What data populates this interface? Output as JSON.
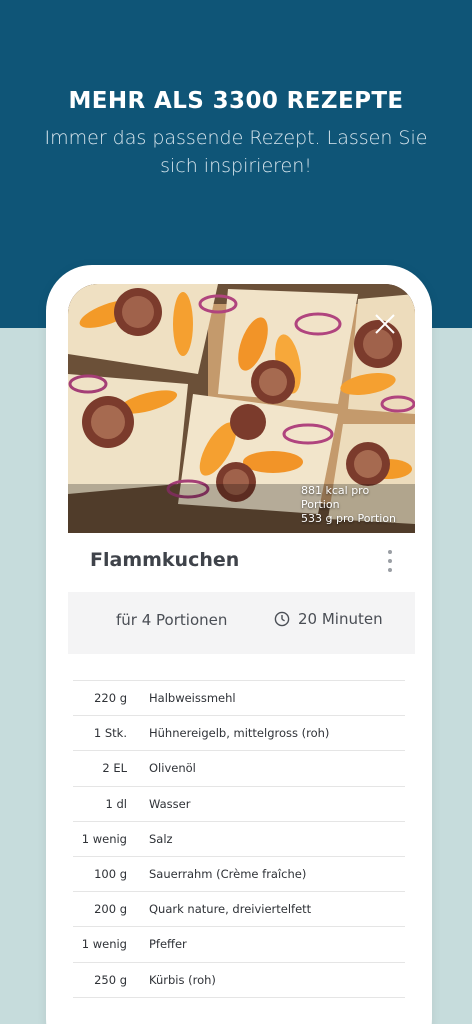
{
  "header": {
    "headline": "MEHR ALS 3300 REZEPTE",
    "subline": "Immer das passende Rezept. Lassen Sie sich inspirieren!"
  },
  "recipe": {
    "nutrition_kcal": "881 kcal pro Portion",
    "nutrition_g": "533 g pro Portion",
    "title": "Flammkuchen",
    "portions": "für 4 Portionen",
    "time": "20 Minuten",
    "ingredients": [
      {
        "amount": "220 g",
        "name": "Halbweissmehl"
      },
      {
        "amount": "1 Stk.",
        "name": "Hühnereigelb, mittelgross (roh)"
      },
      {
        "amount": "2 EL",
        "name": "Olivenöl"
      },
      {
        "amount": "1 dl",
        "name": "Wasser"
      },
      {
        "amount": "1 wenig",
        "name": "Salz"
      },
      {
        "amount": "100 g",
        "name": "Sauerrahm (Crème fraîche)"
      },
      {
        "amount": "200 g",
        "name": "Quark nature, dreiviertelfett"
      },
      {
        "amount": "1 wenig",
        "name": "Pfeffer"
      },
      {
        "amount": "250 g",
        "name": "Kürbis (roh)"
      }
    ]
  },
  "icons": {
    "close": "close-icon",
    "menu": "more-vertical-icon",
    "clock": "clock-icon"
  },
  "colors": {
    "header_bg": "#0f5577",
    "page_bg": "#c6dcdc",
    "title_text": "#3f434a"
  }
}
